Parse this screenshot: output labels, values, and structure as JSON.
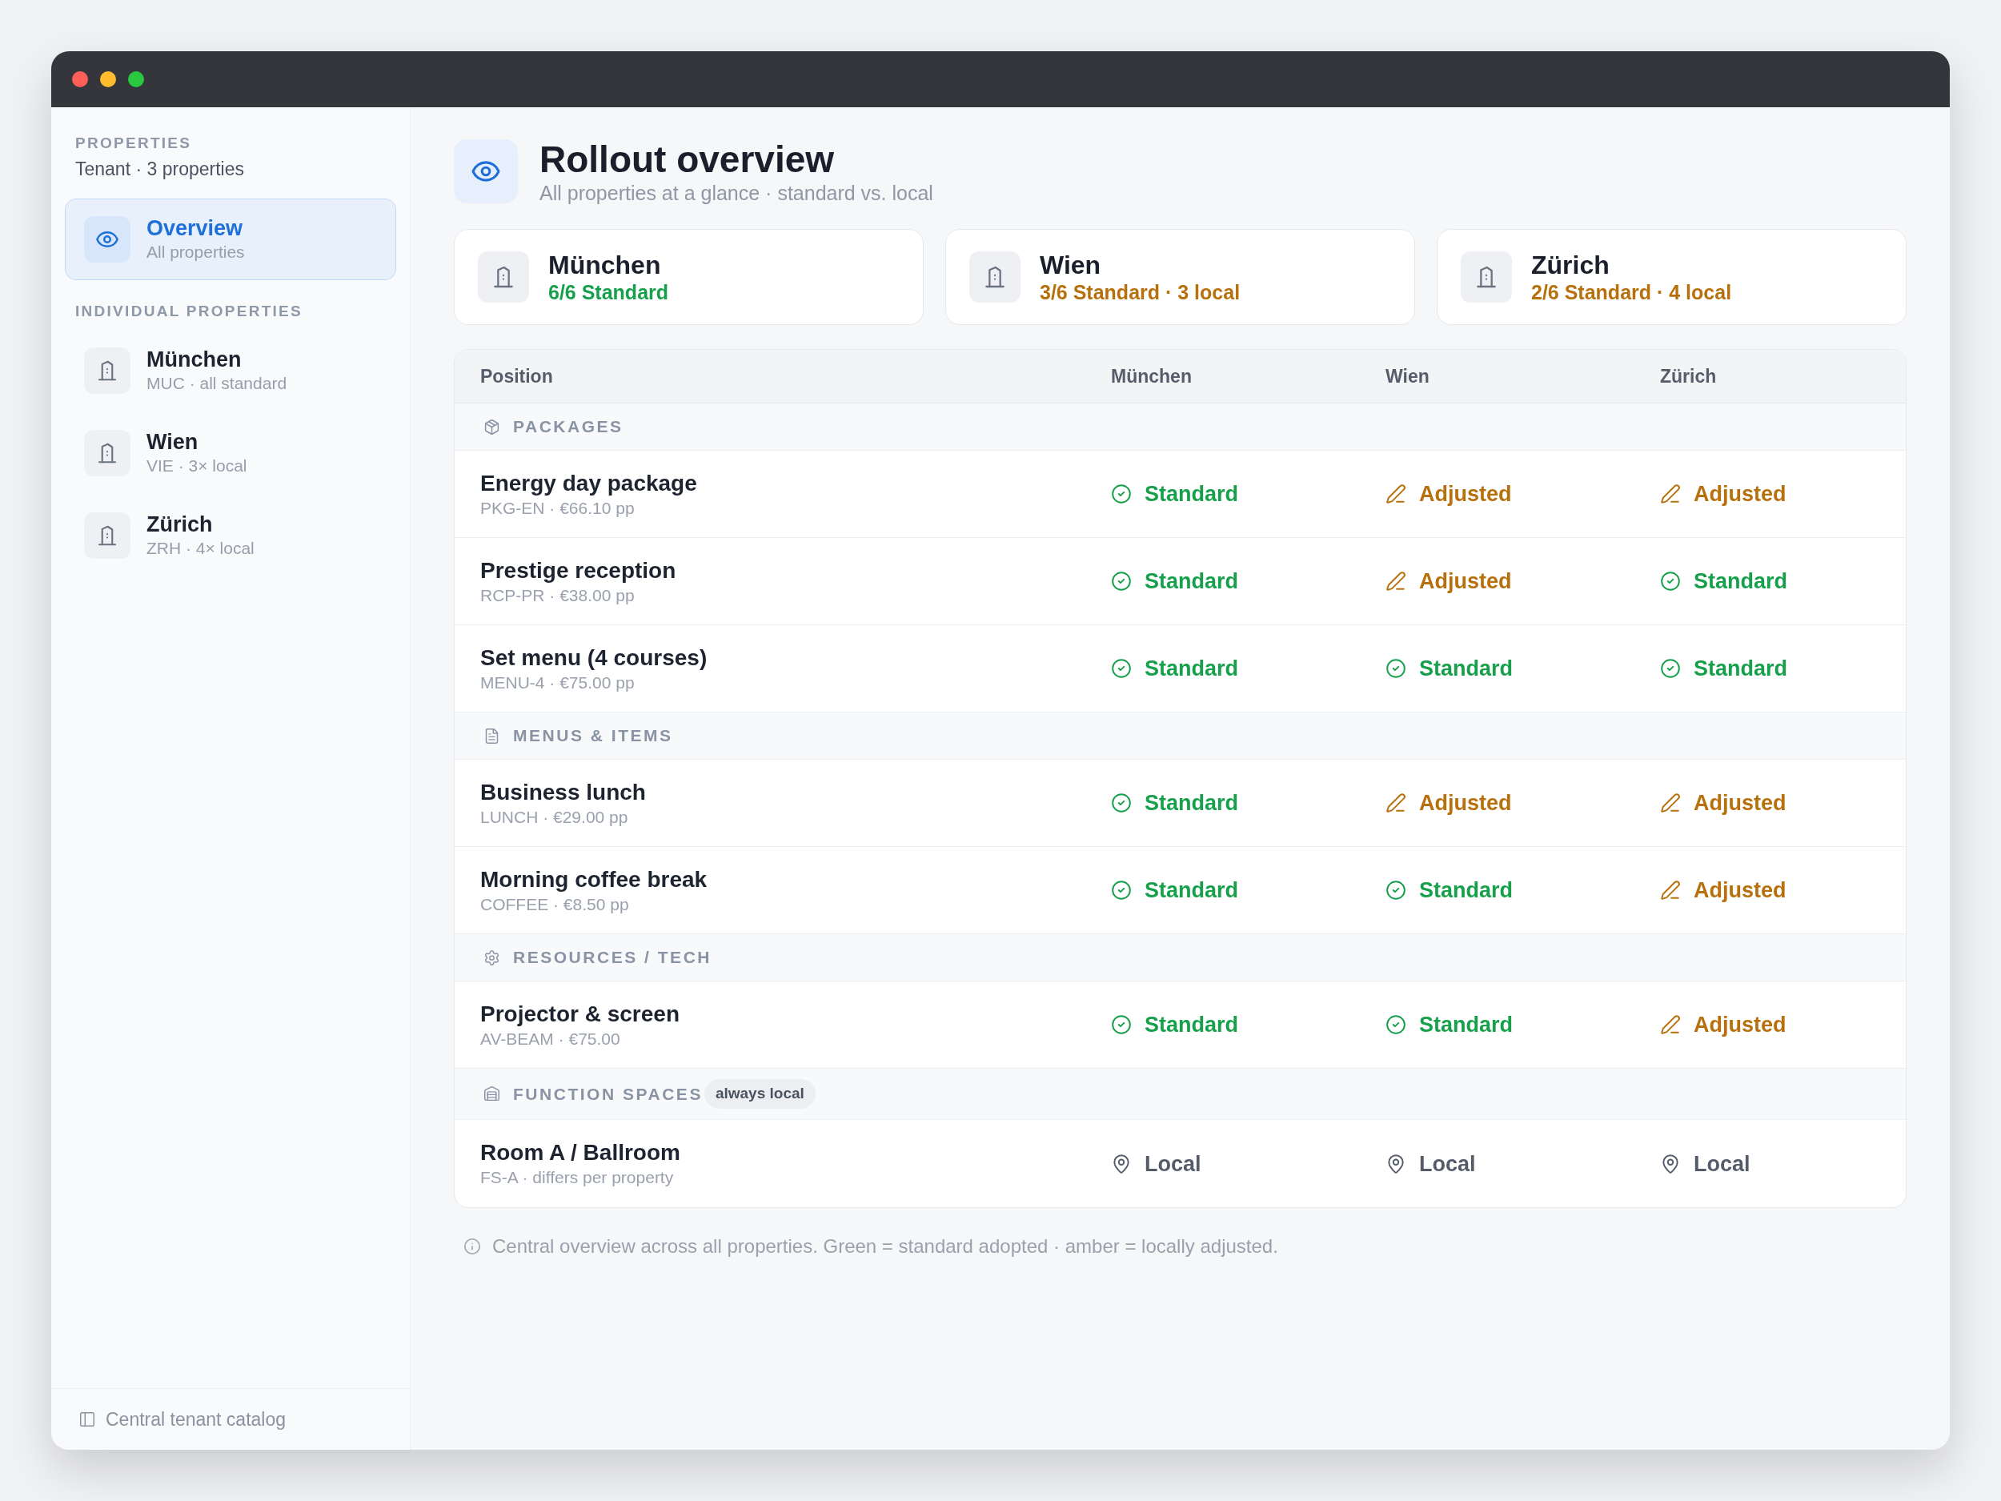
{
  "sidebar": {
    "heading": "PROPERTIES",
    "subtitle": "Tenant · 3 properties",
    "overview": {
      "title": "Overview",
      "subtitle": "All properties",
      "selected": true
    },
    "section_label": "INDIVIDUAL PROPERTIES",
    "items": [
      {
        "title": "München",
        "subtitle": "MUC · all standard",
        "selected": false
      },
      {
        "title": "Wien",
        "subtitle": "VIE · 3× local",
        "selected": false
      },
      {
        "title": "Zürich",
        "subtitle": "ZRH · 4× local",
        "selected": false
      }
    ],
    "footer_link": "Central tenant catalog"
  },
  "header": {
    "title": "Rollout overview",
    "subtitle": "All properties at a glance · standard vs. local"
  },
  "property_cards": [
    {
      "name": "München",
      "summary": "6/6 Standard",
      "color": "#17a04b"
    },
    {
      "name": "Wien",
      "summary": "3/6 Standard · 3 local",
      "color": "#b7700b"
    },
    {
      "name": "Zürich",
      "summary": "2/6 Standard · 4 local",
      "color": "#b7700b"
    }
  ],
  "table": {
    "columns": [
      "Position",
      "München",
      "Wien",
      "Zürich"
    ],
    "sections": [
      {
        "kind": "packages",
        "label": "PACKAGES",
        "rows": [
          {
            "name": "Energy day package",
            "detail": "PKG-EN · €66.10 pp",
            "cells": [
              {
                "kind": "standard",
                "label": "Standard"
              },
              {
                "kind": "adjusted",
                "label": "Adjusted"
              },
              {
                "kind": "adjusted",
                "label": "Adjusted"
              }
            ]
          },
          {
            "name": "Prestige reception",
            "detail": "RCP-PR · €38.00 pp",
            "cells": [
              {
                "kind": "standard",
                "label": "Standard"
              },
              {
                "kind": "adjusted",
                "label": "Adjusted"
              },
              {
                "kind": "standard",
                "label": "Standard"
              }
            ]
          },
          {
            "name": "Set menu (4 courses)",
            "detail": "MENU-4 · €75.00 pp",
            "cells": [
              {
                "kind": "standard",
                "label": "Standard"
              },
              {
                "kind": "standard",
                "label": "Standard"
              },
              {
                "kind": "standard",
                "label": "Standard"
              }
            ]
          }
        ]
      },
      {
        "kind": "menus",
        "label": "MENUS & ITEMS",
        "rows": [
          {
            "name": "Business lunch",
            "detail": "LUNCH · €29.00 pp",
            "cells": [
              {
                "kind": "standard",
                "label": "Standard"
              },
              {
                "kind": "adjusted",
                "label": "Adjusted"
              },
              {
                "kind": "adjusted",
                "label": "Adjusted"
              }
            ]
          },
          {
            "name": "Morning coffee break",
            "detail": "COFFEE · €8.50 pp",
            "cells": [
              {
                "kind": "standard",
                "label": "Standard"
              },
              {
                "kind": "standard",
                "label": "Standard"
              },
              {
                "kind": "adjusted",
                "label": "Adjusted"
              }
            ]
          }
        ]
      },
      {
        "kind": "resources",
        "label": "RESOURCES / TECH",
        "rows": [
          {
            "name": "Projector & screen",
            "detail": "AV-BEAM · €75.00",
            "cells": [
              {
                "kind": "standard",
                "label": "Standard"
              },
              {
                "kind": "standard",
                "label": "Standard"
              },
              {
                "kind": "adjusted",
                "label": "Adjusted"
              }
            ]
          }
        ]
      },
      {
        "kind": "spaces",
        "label": "FUNCTION SPACES",
        "badge": "always local",
        "rows": [
          {
            "name": "Room A / Ballroom",
            "detail": "FS-A · differs per property",
            "cells": [
              {
                "kind": "local",
                "label": "Local"
              },
              {
                "kind": "local",
                "label": "Local"
              },
              {
                "kind": "local",
                "label": "Local"
              }
            ]
          }
        ]
      }
    ]
  },
  "footnote": "Central overview across all properties. Green = standard adopted · amber = locally adjusted."
}
